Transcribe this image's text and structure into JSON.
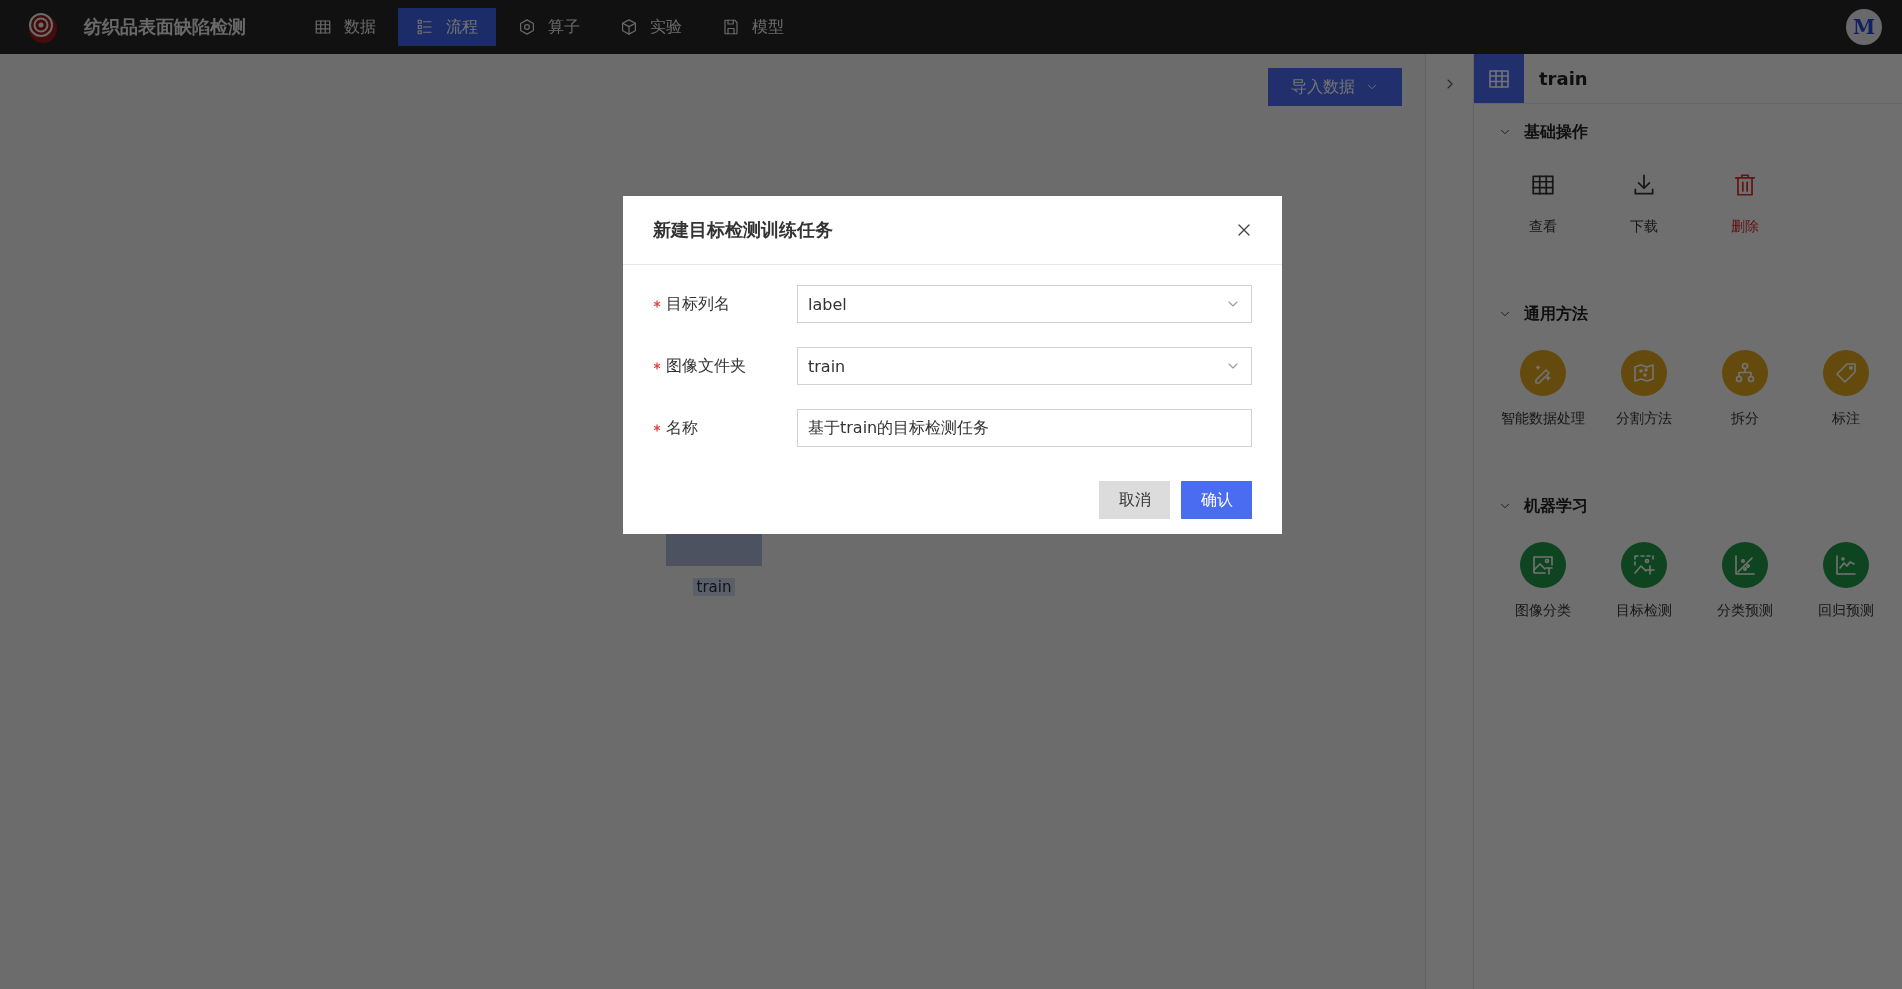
{
  "app": {
    "title": "纺织品表面缺陷检测"
  },
  "nav": [
    {
      "label": "数据",
      "selected": false
    },
    {
      "label": "流程",
      "selected": true
    },
    {
      "label": "算子",
      "selected": false
    },
    {
      "label": "实验",
      "selected": false
    },
    {
      "label": "模型",
      "selected": false
    }
  ],
  "user": {
    "avatar": "M"
  },
  "canvas": {
    "import_button": "导入数据",
    "nodes": [
      {
        "label": "train"
      }
    ]
  },
  "panel": {
    "title": "train",
    "sections": [
      {
        "title": "基础操作",
        "expanded": true,
        "items": [
          {
            "label": "查看",
            "kind": "plain"
          },
          {
            "label": "下载",
            "kind": "plain"
          },
          {
            "label": "删除",
            "kind": "danger"
          }
        ]
      },
      {
        "title": "通用方法",
        "expanded": true,
        "items": [
          {
            "label": "智能数据处理",
            "kind": "method"
          },
          {
            "label": "分割方法",
            "kind": "method"
          },
          {
            "label": "拆分",
            "kind": "method"
          },
          {
            "label": "标注",
            "kind": "method"
          }
        ]
      },
      {
        "title": "机器学习",
        "expanded": true,
        "items": [
          {
            "label": "图像分类",
            "kind": "model"
          },
          {
            "label": "目标检测",
            "kind": "model"
          },
          {
            "label": "分类预测",
            "kind": "model"
          },
          {
            "label": "回归预测",
            "kind": "model"
          }
        ]
      }
    ]
  },
  "dialog": {
    "title": "新建目标检测训练任务",
    "fields": [
      {
        "label": "目标列名",
        "required": true,
        "kind": "select",
        "value": "label"
      },
      {
        "label": "图像文件夹",
        "required": true,
        "kind": "select",
        "value": "train"
      },
      {
        "label": "名称",
        "required": true,
        "kind": "text",
        "value": "基于train的目标检测任务"
      }
    ],
    "buttons": [
      {
        "label": "取消",
        "kind": "secondary"
      },
      {
        "label": "确认",
        "kind": "primary"
      }
    ]
  }
}
